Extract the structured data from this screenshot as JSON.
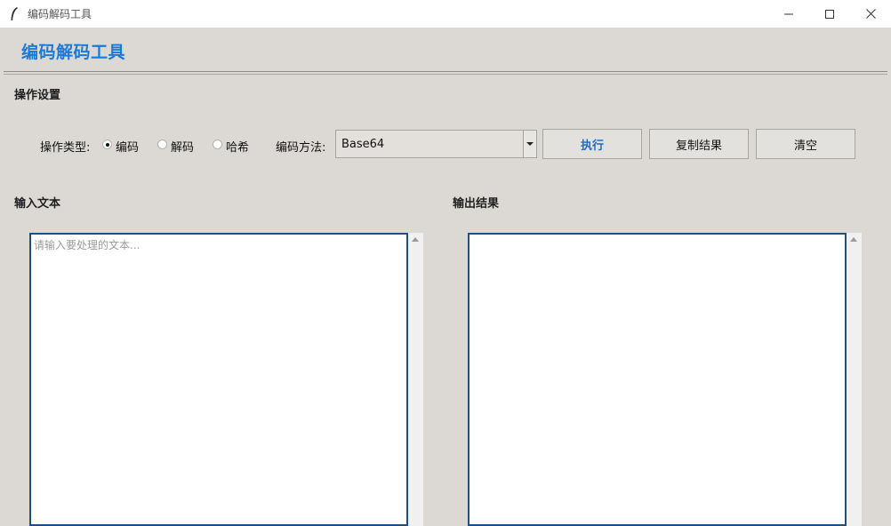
{
  "window": {
    "title": "编码解码工具",
    "controls": [
      "minimize-icon",
      "maximize-icon",
      "close-icon"
    ]
  },
  "header": {
    "app_title": "编码解码工具",
    "accent_color": "#1c7ad6"
  },
  "settings": {
    "section_title": "操作设置",
    "operation_label": "操作类型:",
    "radios": [
      {
        "label": "编码",
        "checked": true
      },
      {
        "label": "解码",
        "checked": false
      },
      {
        "label": "哈希",
        "checked": false
      }
    ],
    "method_label": "编码方法:",
    "method_value": "Base64",
    "buttons": {
      "execute": "执行",
      "copy": "复制结果",
      "clear": "清空"
    }
  },
  "input": {
    "section_title": "输入文本",
    "placeholder": "请输入要处理的文本..."
  },
  "output": {
    "section_title": "输出结果",
    "value": ""
  }
}
